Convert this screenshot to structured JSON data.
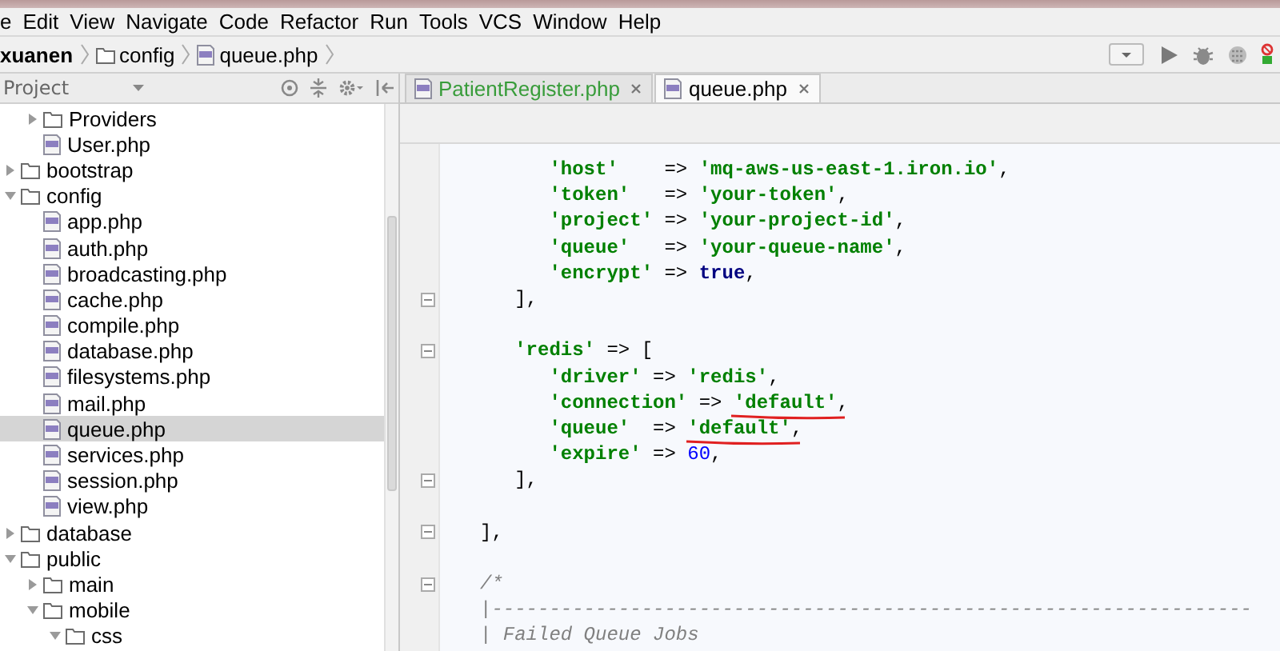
{
  "menu": [
    "e",
    "Edit",
    "View",
    "Navigate",
    "Code",
    "Refactor",
    "Run",
    "Tools",
    "VCS",
    "Window",
    "Help"
  ],
  "breadcrumbs": [
    {
      "label": "xuanen",
      "kind": "root"
    },
    {
      "label": "config",
      "kind": "folder"
    },
    {
      "label": "queue.php",
      "kind": "file"
    }
  ],
  "project_panel": {
    "title": "Project"
  },
  "tree": [
    {
      "children": [
        {
          "label": "Providers",
          "kind": "folder",
          "expanded": false,
          "selected": false
        },
        {
          "label": "User.php",
          "kind": "file",
          "selected": false
        }
      ]
    },
    {
      "label": "bootstrap",
      "kind": "folder",
      "expanded": false,
      "selected": false
    },
    {
      "label": "config",
      "kind": "folder",
      "expanded": true,
      "selected": false,
      "children": [
        {
          "label": "app.php",
          "kind": "file",
          "selected": false
        },
        {
          "label": "auth.php",
          "kind": "file",
          "selected": false
        },
        {
          "label": "broadcasting.php",
          "kind": "file",
          "selected": false
        },
        {
          "label": "cache.php",
          "kind": "file",
          "selected": false
        },
        {
          "label": "compile.php",
          "kind": "file",
          "selected": false
        },
        {
          "label": "database.php",
          "kind": "file",
          "selected": false
        },
        {
          "label": "filesystems.php",
          "kind": "file",
          "selected": false
        },
        {
          "label": "mail.php",
          "kind": "file",
          "selected": false
        },
        {
          "label": "queue.php",
          "kind": "file",
          "selected": true
        },
        {
          "label": "services.php",
          "kind": "file",
          "selected": false
        },
        {
          "label": "session.php",
          "kind": "file",
          "selected": false
        },
        {
          "label": "view.php",
          "kind": "file",
          "selected": false
        }
      ]
    },
    {
      "label": "database",
      "kind": "folder",
      "expanded": false,
      "selected": false
    },
    {
      "label": "public",
      "kind": "folder",
      "expanded": true,
      "selected": false,
      "children": [
        {
          "label": "main",
          "kind": "folder",
          "expanded": false,
          "selected": false
        },
        {
          "label": "mobile",
          "kind": "folder",
          "expanded": true,
          "selected": false,
          "children": [
            {
              "label": "css",
              "kind": "folder",
              "expanded": true,
              "selected": false
            }
          ]
        }
      ]
    }
  ],
  "tabs": [
    {
      "label": "PatientRegister.php",
      "selected": false,
      "color": "#389c3a"
    },
    {
      "label": "queue.php",
      "selected": true,
      "color": "#000000"
    }
  ],
  "code": {
    "lines": [
      {
        "kind": "code",
        "tokens": [
          {
            "kind": "str",
            "text": "      'host'"
          },
          {
            "kind": "text",
            "text": "    => "
          },
          {
            "kind": "str",
            "text": "'mq-aws-us-east-1.iron.io'"
          },
          {
            "kind": "text",
            "text": ","
          }
        ]
      },
      {
        "kind": "code",
        "tokens": [
          {
            "kind": "str",
            "text": "      'token'"
          },
          {
            "kind": "text",
            "text": "   => "
          },
          {
            "kind": "str",
            "text": "'your-token'"
          },
          {
            "kind": "text",
            "text": ","
          }
        ]
      },
      {
        "kind": "code",
        "tokens": [
          {
            "kind": "str",
            "text": "      'project'"
          },
          {
            "kind": "text",
            "text": " => "
          },
          {
            "kind": "str",
            "text": "'your-project-id'"
          },
          {
            "kind": "text",
            "text": ","
          }
        ]
      },
      {
        "kind": "code",
        "tokens": [
          {
            "kind": "str",
            "text": "      'queue'"
          },
          {
            "kind": "text",
            "text": "   => "
          },
          {
            "kind": "str",
            "text": "'your-queue-name'"
          },
          {
            "kind": "text",
            "text": ","
          }
        ]
      },
      {
        "kind": "code",
        "tokens": [
          {
            "kind": "str",
            "text": "      'encrypt'"
          },
          {
            "kind": "text",
            "text": " => "
          },
          {
            "kind": "kw",
            "text": "true"
          },
          {
            "kind": "text",
            "text": ","
          }
        ]
      },
      {
        "kind": "code",
        "fold": true,
        "tokens": [
          {
            "kind": "text",
            "text": "   ],"
          }
        ]
      },
      {
        "kind": "blank"
      },
      {
        "kind": "code",
        "fold": true,
        "tokens": [
          {
            "kind": "str",
            "text": "   'redis'"
          },
          {
            "kind": "text",
            "text": " => ["
          }
        ]
      },
      {
        "kind": "code",
        "tokens": [
          {
            "kind": "str",
            "text": "      'driver'"
          },
          {
            "kind": "text",
            "text": " => "
          },
          {
            "kind": "str",
            "text": "'redis'"
          },
          {
            "kind": "text",
            "text": ","
          }
        ]
      },
      {
        "kind": "code",
        "tokens": [
          {
            "kind": "str",
            "text": "      'connection'"
          },
          {
            "kind": "text",
            "text": " => "
          },
          {
            "kind": "str",
            "text": "'default'",
            "underlined": true
          },
          {
            "kind": "text",
            "text": ","
          }
        ]
      },
      {
        "kind": "code",
        "tokens": [
          {
            "kind": "str",
            "text": "      'queue'"
          },
          {
            "kind": "text",
            "text": "  => "
          },
          {
            "kind": "str",
            "text": "'default'",
            "underlined": true
          },
          {
            "kind": "text",
            "text": ","
          }
        ]
      },
      {
        "kind": "code",
        "tokens": [
          {
            "kind": "str",
            "text": "      'expire'"
          },
          {
            "kind": "text",
            "text": " => "
          },
          {
            "kind": "num",
            "text": "60"
          },
          {
            "kind": "text",
            "text": ","
          }
        ]
      },
      {
        "kind": "code",
        "fold": true,
        "tokens": [
          {
            "kind": "text",
            "text": "   ],"
          }
        ]
      },
      {
        "kind": "blank"
      },
      {
        "kind": "code",
        "fold": true,
        "tokens": [
          {
            "kind": "text",
            "text": "],"
          }
        ]
      },
      {
        "kind": "blank"
      },
      {
        "kind": "code",
        "fold": true,
        "tokens": [
          {
            "kind": "comment",
            "text": "/*"
          }
        ]
      },
      {
        "kind": "code",
        "tokens": [
          {
            "kind": "comment",
            "text": "|------------------------------------------------------------------"
          }
        ]
      },
      {
        "kind": "code",
        "tokens": [
          {
            "kind": "comment",
            "text": "| Failed Queue Jobs"
          }
        ]
      }
    ]
  }
}
